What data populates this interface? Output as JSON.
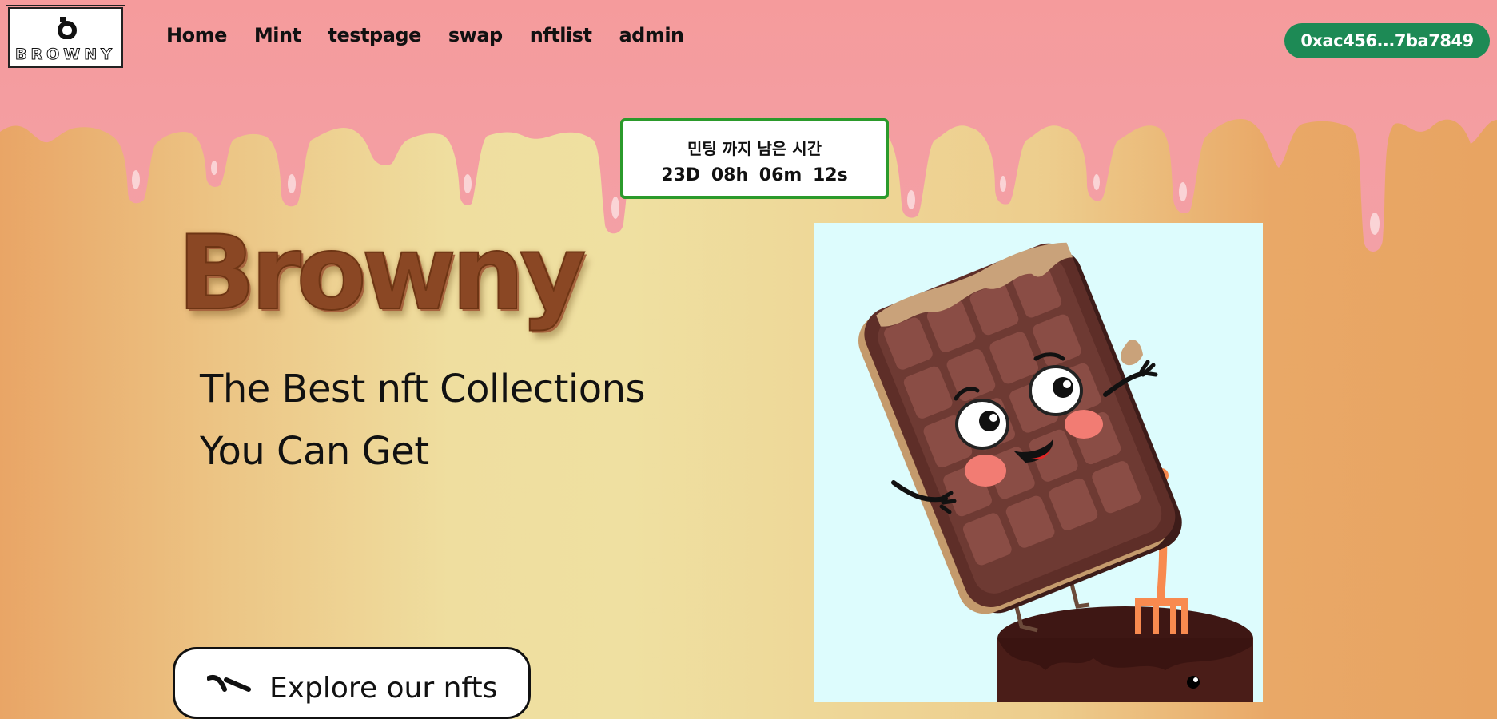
{
  "brand": {
    "logo_text": "BROWNY"
  },
  "nav": {
    "links": [
      {
        "label": "Home"
      },
      {
        "label": "Mint"
      },
      {
        "label": "testpage"
      },
      {
        "label": "swap"
      },
      {
        "label": "nftlist"
      },
      {
        "label": "admin"
      }
    ]
  },
  "wallet": {
    "address": "0xac456...7ba7849"
  },
  "countdown": {
    "title": "민팅 까지 남은 시간",
    "days": "23D",
    "hours": "08h",
    "minutes": "06m",
    "seconds": "12s"
  },
  "hero": {
    "title": "Browny",
    "tagline_line1": "The Best nft Collections",
    "tagline_line2": "You Can Get",
    "explore_label": "Explore our nfts"
  },
  "colors": {
    "icing": "#f49a9a",
    "wallet_button": "#1d8a55",
    "timer_border": "#2b9a2b",
    "brand_brown": "#8a4724",
    "hero_image_bg": "#ddfcfd"
  },
  "icons": {
    "logo_mark": "browny-logo-mark",
    "explore": "arrow-icon",
    "hero": "chocolate-waffle-mascot"
  }
}
